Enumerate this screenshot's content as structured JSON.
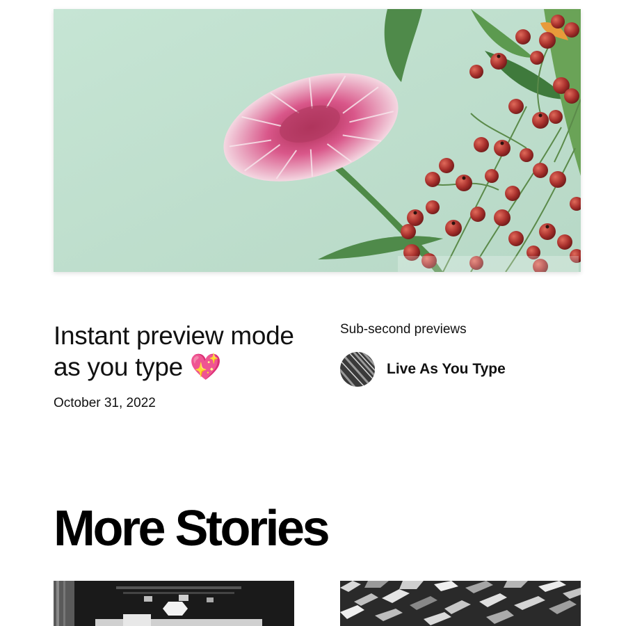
{
  "hero": {
    "image_alt": "Pink chrysanthemum flower with red berries on a mint green background"
  },
  "post": {
    "title": "Instant preview mode as you type 💖",
    "date": "October 31, 2022",
    "excerpt": "Sub-second previews",
    "author_name": "Live As You Type"
  },
  "more_stories": {
    "heading": "More Stories"
  },
  "colors": {
    "hero_background": "#c4e2d2",
    "flower_pink": "#d9578a",
    "berry_red": "#a8302c",
    "leaf_green": "#4f8a4a",
    "text": "#111111"
  }
}
